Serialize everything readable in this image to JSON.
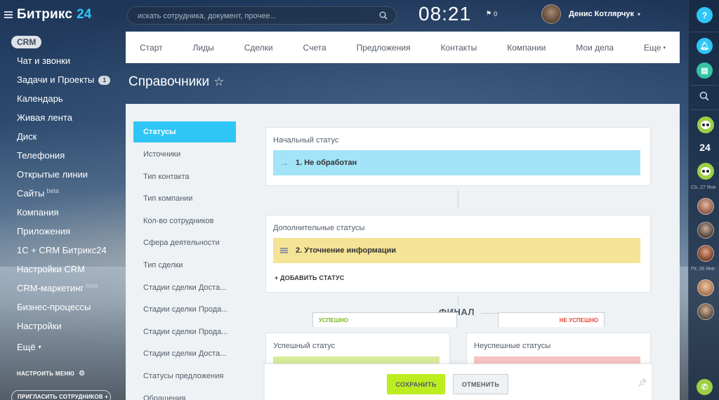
{
  "app": {
    "logo_text": "Битрикс",
    "logo_number": "24"
  },
  "sidebar": {
    "section_badge": "CRM",
    "items": [
      {
        "label": "Чат и звонки",
        "sup": "",
        "count": ""
      },
      {
        "label": "Задачи и Проекты",
        "sup": "",
        "count": "1"
      },
      {
        "label": "Календарь",
        "sup": "",
        "count": ""
      },
      {
        "label": "Живая лента",
        "sup": "",
        "count": ""
      },
      {
        "label": "Диск",
        "sup": "",
        "count": ""
      },
      {
        "label": "Телефония",
        "sup": "",
        "count": ""
      },
      {
        "label": "Открытые линии",
        "sup": "",
        "count": ""
      },
      {
        "label": "Сайты",
        "sup": "beta",
        "count": ""
      },
      {
        "label": "Компания",
        "sup": "",
        "count": ""
      },
      {
        "label": "Приложения",
        "sup": "",
        "count": ""
      },
      {
        "label": "1С + CRM Битрикс24",
        "sup": "",
        "count": ""
      },
      {
        "label": "Настройки CRM",
        "sup": "",
        "count": ""
      },
      {
        "label": "CRM-маркетинг",
        "sup": "beta",
        "count": ""
      },
      {
        "label": "Бизнес-процессы",
        "sup": "",
        "count": ""
      },
      {
        "label": "Настройки",
        "sup": "",
        "count": ""
      },
      {
        "label": "Ещё",
        "sup": "",
        "count": ""
      }
    ],
    "more_caret": "▾",
    "setup_menu": "НАСТРОИТЬ МЕНЮ",
    "invite": "ПРИГЛАСИТЬ СОТРУДНИКОВ +"
  },
  "header": {
    "search_placeholder": "искать сотрудника, документ, прочее...",
    "time": "08:21",
    "flag_count": "0",
    "user_name": "Денис Котлярчук"
  },
  "topnav": {
    "items": [
      "Старт",
      "Лиды",
      "Сделки",
      "Счета",
      "Предложения",
      "Контакты",
      "Компании",
      "Мои дела"
    ],
    "more": "Еще"
  },
  "page": {
    "title": "Справочники"
  },
  "subnav": {
    "items": [
      "Статусы",
      "Источники",
      "Тип контакта",
      "Тип компании",
      "Кол-во сотрудников",
      "Сфера деятельности",
      "Тип сделки",
      "Стадии сделки Доста...",
      "Стадии сделки Прода...",
      "Стадии сделки Прода...",
      "Стадии сделки Доста...",
      "Статусы предложения",
      "Обращения"
    ],
    "active_index": 0
  },
  "statuses": {
    "initial_title": "Начальный статус",
    "initial_item": "1. Не обработан",
    "initial_color": "#a3e4f8",
    "additional_title": "Дополнительные статусы",
    "additional_item": "2. Уточнение информации",
    "additional_color": "#f5e396",
    "add_status": "+ ДОБАВИТЬ СТАТУС",
    "final_label": "ФИНАЛ",
    "success_tab": "УСПЕШНО",
    "fail_tab": "НЕ УСПЕШНО",
    "success_title": "Успешный статус",
    "success_color": "#d8ec9a",
    "fail_title": "Неуспешные статусы",
    "fail_color": "#f8c3c0"
  },
  "actions": {
    "save": "СОХРАНИТЬ",
    "cancel": "ОТМЕНИТЬ"
  },
  "right_bar": {
    "date1": "Сб, 27 Янв",
    "date2": "Пт, 26 Янв",
    "counter": "24"
  }
}
